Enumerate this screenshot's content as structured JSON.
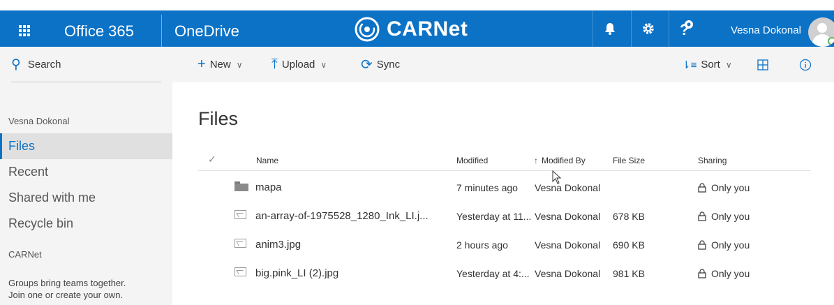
{
  "suitebar": {
    "brand": "Office 365",
    "app": "OneDrive",
    "logo_text": "CARNet",
    "user_name": "Vesna Dokonal",
    "accent": "#0b72c6"
  },
  "commandbar": {
    "new_label": "New",
    "upload_label": "Upload",
    "sync_label": "Sync",
    "sort_label": "Sort"
  },
  "leftnav": {
    "search_label": "Search",
    "owner_heading": "Vesna Dokonal",
    "items": [
      {
        "label": "Files",
        "active": true
      },
      {
        "label": "Recent"
      },
      {
        "label": "Shared with me"
      },
      {
        "label": "Recycle bin"
      }
    ],
    "groups_heading": "CARNet",
    "groups_note_line1": "Groups bring teams together.",
    "groups_note_line2": "Join one or create your own."
  },
  "main": {
    "title": "Files",
    "columns": {
      "name": "Name",
      "modified": "Modified",
      "modified_by": "Modified By",
      "file_size": "File Size",
      "sharing": "Sharing"
    },
    "rows": [
      {
        "type": "folder",
        "name": "mapa",
        "modified": "7 minutes ago",
        "modified_by": "Vesna Dokonal",
        "size": "",
        "sharing": "Only you"
      },
      {
        "type": "image",
        "name": "an-array-of-1975528_1280_Ink_LI.j...",
        "modified": "Yesterday at 11...",
        "modified_by": "Vesna Dokonal",
        "size": "678 KB",
        "sharing": "Only you"
      },
      {
        "type": "image",
        "name": "anim3.jpg",
        "modified": "2 hours ago",
        "modified_by": "Vesna Dokonal",
        "size": "690 KB",
        "sharing": "Only you"
      },
      {
        "type": "image",
        "name": "big.pink_LI (2).jpg",
        "modified": "Yesterday at 4:...",
        "modified_by": "Vesna Dokonal",
        "size": "981 KB",
        "sharing": "Only you"
      }
    ]
  }
}
